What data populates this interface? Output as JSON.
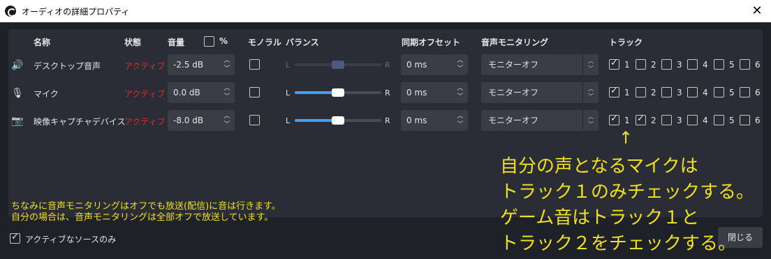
{
  "window": {
    "title": "オーディオの詳細プロパティ"
  },
  "headers": {
    "name": "名称",
    "status": "状態",
    "volume": "音量",
    "percent": "%",
    "mono": "モノラル",
    "balance": "バランス",
    "sync_offset": "同期オフセット",
    "monitoring": "音声モニタリング",
    "tracks": "トラック"
  },
  "balance_labels": {
    "left": "L",
    "right": "R"
  },
  "rows": [
    {
      "icon": "speaker-icon",
      "name": "デスクトップ音声",
      "status": "アクティブ",
      "volume": "-2.5 dB",
      "mono": false,
      "balance": 0.5,
      "balance_disabled": true,
      "sync_offset": "0 ms",
      "monitoring": "モニターオフ",
      "tracks": [
        true,
        false,
        false,
        false,
        false,
        false
      ]
    },
    {
      "icon": "microphone-icon",
      "name": "マイク",
      "status": "アクティブ",
      "volume": "0.0 dB",
      "mono": false,
      "balance": 0.5,
      "balance_disabled": false,
      "sync_offset": "0 ms",
      "monitoring": "モニターオフ",
      "tracks": [
        true,
        false,
        false,
        false,
        false,
        false
      ]
    },
    {
      "icon": "camera-icon",
      "name": "映像キャプチャデバイス",
      "status": "アクティブ",
      "volume": "-8.0 dB",
      "mono": false,
      "balance": 0.5,
      "balance_disabled": false,
      "sync_offset": "0 ms",
      "monitoring": "モニターオフ",
      "tracks": [
        true,
        true,
        false,
        false,
        false,
        false
      ]
    }
  ],
  "track_numbers": [
    "1",
    "2",
    "3",
    "4",
    "5",
    "6"
  ],
  "notes": {
    "line1": "ちなみに音声モニタリングはオフでも放送(配信)に音は行きます。",
    "line2": "自分の場合は、音声モニタリングは全部オフで放送しています。"
  },
  "annotation": {
    "arrow": "↑",
    "line1": "自分の声となるマイクは",
    "line2": "トラック１のみチェックする。",
    "line3": "ゲーム音はトラック１と",
    "line4": "トラック２をチェックする。"
  },
  "footer": {
    "active_only_label": "アクティブなソースのみ",
    "active_only_checked": true,
    "close_label": "閉じる"
  },
  "colors": {
    "status_active": "#e0282c",
    "annotation": "#f0e020",
    "slider_fill": "#3fa0ff",
    "background": "#1f2128",
    "panel": "#2b2d36"
  }
}
